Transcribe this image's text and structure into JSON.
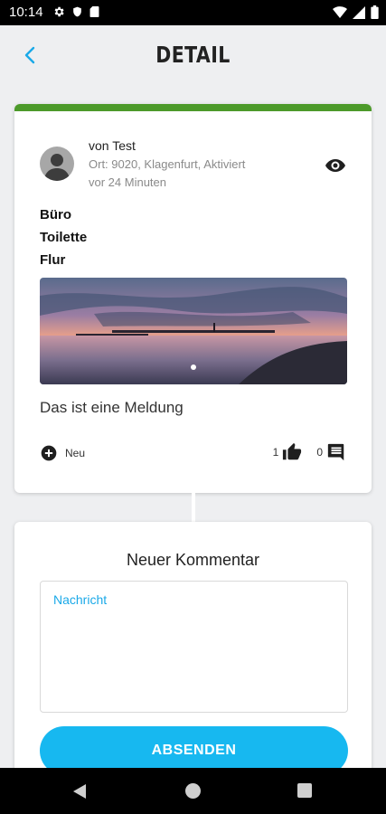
{
  "status_bar": {
    "time": "10:14"
  },
  "header": {
    "title": "DETAIL",
    "accent_color": "#1aa9e8"
  },
  "post": {
    "accent_color": "#4c9a2a",
    "author": "von Test",
    "location": "Ort: 9020, Klagenfurt, Aktiviert",
    "time_ago": "vor 24 Minuten",
    "categories": [
      "Büro",
      "Toilette",
      "Flur"
    ],
    "text": "Das ist eine Meldung",
    "status": "Neu",
    "likes": "1",
    "comments": "0"
  },
  "comment_form": {
    "heading": "Neuer Kommentar",
    "placeholder": "Nachricht",
    "submit_label": "ABSENDEN",
    "button_color": "#17b8f0"
  }
}
